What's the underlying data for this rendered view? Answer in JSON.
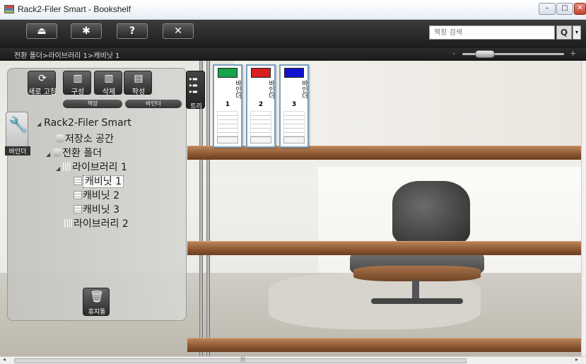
{
  "window": {
    "title": "Rack2-Filer Smart - Bookshelf",
    "min_glyph": "–",
    "max_glyph": "□",
    "close_glyph": "✕"
  },
  "toolbar": {
    "buttons": [
      {
        "glyph": "⏏",
        "icon": "eject-icon"
      },
      {
        "glyph": "✱",
        "icon": "gear-icon"
      },
      {
        "glyph": "?",
        "icon": "help-icon"
      },
      {
        "glyph": "✕",
        "icon": "close-icon"
      }
    ],
    "search_placeholder": "책장 검색",
    "search_glyph": "Q",
    "dropdown_glyph": "▾"
  },
  "breadcrumb": "전환 폴더>라이브러리 1>캐비닛 1",
  "zoom": {
    "minus": "-",
    "plus": "+",
    "level": 0.18
  },
  "panel": {
    "tools": {
      "refresh": "새로 고침",
      "compose": "구성",
      "delete": "삭제",
      "create": "작성"
    },
    "groups": {
      "bookshelf": "책장",
      "binder": "바인더"
    },
    "tree_tab": "트리",
    "binder_tab": "바인더",
    "trash": "휴지통",
    "tree": {
      "root": "Rack2-Filer Smart",
      "storage": "저장소 공간",
      "convert_folder": "전환 폴더",
      "library1": "라이브러리 1",
      "cabinet1": "캐비닛 1",
      "cabinet2": "캐비닛 2",
      "cabinet3": "캐비닛 3",
      "library2": "라이브러리 2"
    }
  },
  "binders": [
    {
      "title": "바인더",
      "number": "1",
      "color": "#17a34a"
    },
    {
      "title": "바인더",
      "number": "2",
      "color": "#d81e1e"
    },
    {
      "title": "바인더",
      "number": "3",
      "color": "#1212d0"
    }
  ],
  "scrollbar": {
    "grip": "|||",
    "left_arrow": "◂",
    "right_arrow": "▸"
  }
}
